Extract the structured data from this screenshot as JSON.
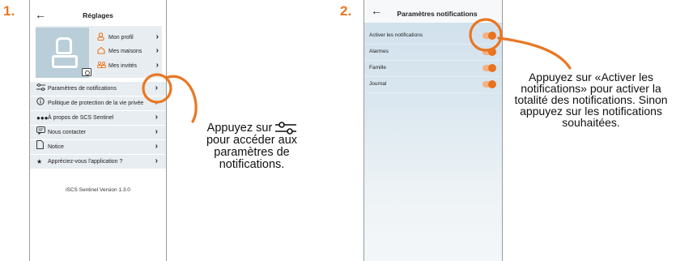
{
  "steps": {
    "one": "1.",
    "two": "2."
  },
  "screen1": {
    "title": "Réglages",
    "profile_items": [
      {
        "icon": "person-icon",
        "label": "Mon profil"
      },
      {
        "icon": "house-icon",
        "label": "Mes maisons"
      },
      {
        "icon": "guests-icon",
        "label": "Mes invités"
      }
    ],
    "menu": [
      {
        "icon": "sliders-icon",
        "label": "Paramètres de notifications"
      },
      {
        "icon": "info-icon",
        "label": "Politique de protection de la vie privée"
      },
      {
        "icon": "dots-icon",
        "label": "À propos de SCS Sentinel"
      },
      {
        "icon": "chat-icon",
        "label": "Nous contacter"
      },
      {
        "icon": "document-icon",
        "label": "Notice"
      },
      {
        "icon": "star-icon",
        "label": "Appréciez-vous l'application ?"
      }
    ],
    "version": "iSCS Sentinel Version 1.3.0"
  },
  "screen2": {
    "title": "Paramètres notifications",
    "rows": [
      {
        "label": "Activer les notifications",
        "on": true
      },
      {
        "label": "Alarmes",
        "on": true
      },
      {
        "label": "Famille",
        "on": true
      },
      {
        "label": "Journal",
        "on": true
      }
    ]
  },
  "callout1": {
    "before_icon": "Appuyez sur",
    "after_icon": "pour accéder aux paramètres de notifications."
  },
  "callout2": {
    "text": "Appuyez sur «Activer les notifications» pour activer la totalité des notifications. Sinon appuyez sur les notifications souhaitées."
  },
  "colors": {
    "accent": "#e87722",
    "panel": "#e8edf1",
    "avatar": "#b9ced9"
  }
}
